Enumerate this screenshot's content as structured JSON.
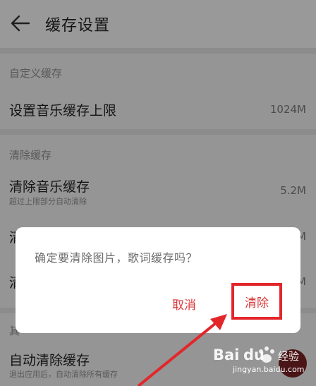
{
  "header": {
    "title": "缓存设置",
    "back_icon": "back-arrow-icon"
  },
  "sections": {
    "custom": {
      "label": "自定义缓存",
      "row_title": "设置音乐缓存上限",
      "row_value": "1024M"
    },
    "clear": {
      "label": "清除缓存",
      "music_title": "清除音乐缓存",
      "music_sub": "超过上限部分自动清除",
      "music_value": "5.2M",
      "row2_partial": "清",
      "row2_value": "M",
      "row3_partial": "清",
      "row3_value": "M"
    },
    "other": {
      "label_partial": "其",
      "auto_title": "自动清除缓存",
      "auto_sub": "退出应用后，自动清除所有缓存"
    }
  },
  "dialog": {
    "message": "确定要清除图片，歌词缓存吗？",
    "cancel_label": "取消",
    "confirm_label": "清除"
  },
  "annotation": {
    "highlight_color": "#e3262a",
    "arrow_color": "#e3262a"
  },
  "watermark": {
    "brand": "Bai du 经验",
    "url": "jingyan.baidu.com"
  }
}
